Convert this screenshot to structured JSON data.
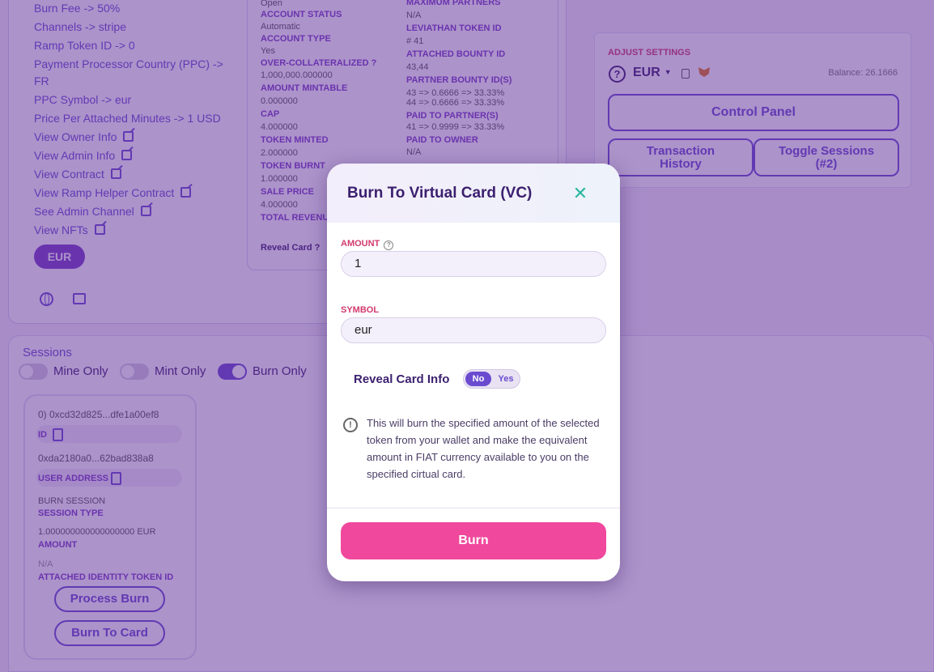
{
  "left": {
    "links": [
      {
        "label": "Burn Fee -> 50%",
        "ext": false
      },
      {
        "label": "Channels -> stripe",
        "ext": false
      },
      {
        "label": "Ramp Token ID -> 0",
        "ext": false
      },
      {
        "label": "Payment Processor Country (PPC) ->",
        "ext": false
      },
      {
        "label": "FR",
        "ext": false
      },
      {
        "label": "PPC Symbol -> eur",
        "ext": false
      },
      {
        "label": "Price Per Attached Minutes -> 1 USD",
        "ext": false
      },
      {
        "label": "View Owner Info",
        "ext": true
      },
      {
        "label": "View Admin Info",
        "ext": true
      },
      {
        "label": "View Contract",
        "ext": true
      },
      {
        "label": "View Ramp Helper Contract",
        "ext": true
      },
      {
        "label": "See Admin Channel",
        "ext": true
      },
      {
        "label": "View NFTs",
        "ext": true
      }
    ],
    "currency_pill": "EUR"
  },
  "info_col1": [
    {
      "k": "v",
      "text": "Open"
    },
    {
      "k": "l",
      "text": "ACCOUNT STATUS"
    },
    {
      "k": "v",
      "text": "Automatic"
    },
    {
      "k": "l",
      "text": "ACCOUNT TYPE"
    },
    {
      "k": "v",
      "text": "Yes"
    },
    {
      "k": "l",
      "text": "OVER-COLLATERALIZED ?"
    },
    {
      "k": "v",
      "text": "1,000,000.000000"
    },
    {
      "k": "l",
      "text": "AMOUNT MINTABLE"
    },
    {
      "k": "v",
      "text": "0.000000"
    },
    {
      "k": "l",
      "text": "CAP"
    },
    {
      "k": "v",
      "text": "4.000000"
    },
    {
      "k": "l",
      "text": "TOKEN MINTED"
    },
    {
      "k": "v",
      "text": "2.000000"
    },
    {
      "k": "l",
      "text": "TOKEN BURNT"
    },
    {
      "k": "v",
      "text": "1.000000"
    },
    {
      "k": "l",
      "text": "SALE PRICE"
    },
    {
      "k": "v",
      "text": "4.000000"
    },
    {
      "k": "l",
      "text": "TOTAL REVENUE"
    }
  ],
  "reveal_card_text": "Reveal Card ?",
  "info_col2": [
    {
      "k": "l",
      "text": "MAXIMUM PARTNERS"
    },
    {
      "k": "v",
      "text": "N/A"
    },
    {
      "k": "l",
      "text": "LEVIATHAN TOKEN ID"
    },
    {
      "k": "v",
      "text": "# 41"
    },
    {
      "k": "l",
      "text": "ATTACHED BOUNTY ID"
    },
    {
      "k": "v",
      "text": "43,44"
    },
    {
      "k": "l",
      "text": "PARTNER BOUNTY ID(S)"
    },
    {
      "k": "v",
      "text": "43 => 0.6666 => 33.33%"
    },
    {
      "k": "v",
      "text": "44 => 0.6666 => 33.33%"
    },
    {
      "k": "l",
      "text": "PAID TO PARTNER(S)"
    },
    {
      "k": "v",
      "text": "41 => 0.9999 => 33.33%"
    },
    {
      "k": "l",
      "text": "PAID TO OWNER"
    },
    {
      "k": "v",
      "text": "N/A"
    }
  ],
  "settings": {
    "title": "ADJUST SETTINGS",
    "currency": "EUR",
    "balance": "Balance: 26.1666",
    "control_panel": "Control Panel",
    "transaction_history": "Transaction History",
    "toggle_sessions": "Toggle Sessions (#2)"
  },
  "sessions": {
    "title": "Sessions",
    "toggles": [
      {
        "label": "Mine Only",
        "on": false
      },
      {
        "label": "Mint Only",
        "on": false
      },
      {
        "label": "Burn Only",
        "on": true
      }
    ],
    "card": {
      "id_value": "0) 0xcd32d825...dfe1a00ef8",
      "id_label": "ID",
      "user_address_value": "0xda2180a0...62bad838a8",
      "user_address_label": "USER ADDRESS",
      "session_type_value": "BURN SESSION",
      "session_type_label": "SESSION TYPE",
      "amount_value": "1.000000000000000000 EUR",
      "amount_label": "AMOUNT",
      "attached_value": "N/A",
      "attached_label": "ATTACHED IDENTITY TOKEN ID",
      "process_burn": "Process Burn",
      "burn_to_card": "Burn To Card"
    }
  },
  "modal": {
    "title": "Burn To Virtual Card (VC)",
    "close_glyph": "✕",
    "amount_label": "AMOUNT",
    "amount_value": "1",
    "symbol_label": "SYMBOL",
    "symbol_value": "eur",
    "reveal_label": "Reveal Card Info",
    "reveal_no": "No",
    "reveal_yes": "Yes",
    "notice": "This will burn the specified amount of the selected token from your wallet and make the equivalent amount in FIAT currency available to you on the specified cirtual card.",
    "burn_button": "Burn"
  }
}
